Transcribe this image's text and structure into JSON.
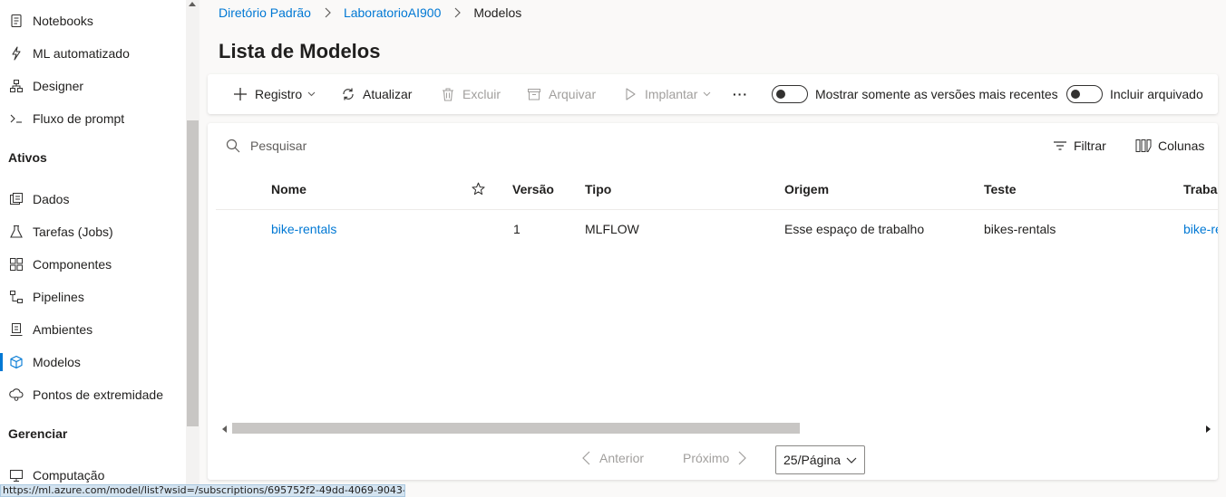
{
  "sidebar": {
    "items": [
      {
        "label": "Notebooks",
        "icon": "notebook-icon"
      },
      {
        "label": "ML automatizado",
        "icon": "automl-icon"
      },
      {
        "label": "Designer",
        "icon": "designer-icon"
      },
      {
        "label": "Fluxo de prompt",
        "icon": "prompt-flow-icon"
      }
    ],
    "section_assets": "Ativos",
    "asset_items": [
      {
        "label": "Dados",
        "icon": "data-icon"
      },
      {
        "label": "Tarefas (Jobs)",
        "icon": "jobs-icon"
      },
      {
        "label": "Componentes",
        "icon": "components-icon"
      },
      {
        "label": "Pipelines",
        "icon": "pipelines-icon"
      },
      {
        "label": "Ambientes",
        "icon": "environments-icon"
      },
      {
        "label": "Modelos",
        "icon": "models-icon",
        "active": true
      },
      {
        "label": "Pontos de extremidade",
        "icon": "endpoints-icon"
      }
    ],
    "section_manage": "Gerenciar",
    "manage_items": [
      {
        "label": "Computação",
        "icon": "compute-icon"
      }
    ]
  },
  "breadcrumb": {
    "items": [
      "Diretório Padrão",
      "LaboratorioAI900"
    ],
    "current": "Modelos"
  },
  "page_title": "Lista de Modelos",
  "toolbar": {
    "register": "Registro",
    "refresh": "Atualizar",
    "delete": "Excluir",
    "archive": "Arquivar",
    "deploy": "Implantar",
    "more": "···",
    "toggle_latest": "Mostrar somente as versões mais recentes",
    "toggle_archived": "Incluir arquivado"
  },
  "grid": {
    "search_placeholder": "Pesquisar",
    "filter": "Filtrar",
    "columns": "Colunas",
    "headers": {
      "name": "Nome",
      "version": "Versão",
      "type": "Tipo",
      "origin": "Origem",
      "test": "Teste",
      "work": "Trabalh"
    },
    "rows": [
      {
        "name": "bike-rentals",
        "version": "1",
        "type": "MLFLOW",
        "origin": "Esse espaço de trabalho",
        "test": "bikes-rentals",
        "work": "bike-re"
      }
    ]
  },
  "pager": {
    "prev": "Anterior",
    "next": "Próximo",
    "page_size": "25/Página"
  },
  "status_url": "https://ml.azure.com/model/list?wsid=/subscriptions/695752f2-49dd-4069-9043-...",
  "colors": {
    "accent": "#0078d4",
    "text": "#201f1e",
    "disabled": "#a19f9d"
  }
}
